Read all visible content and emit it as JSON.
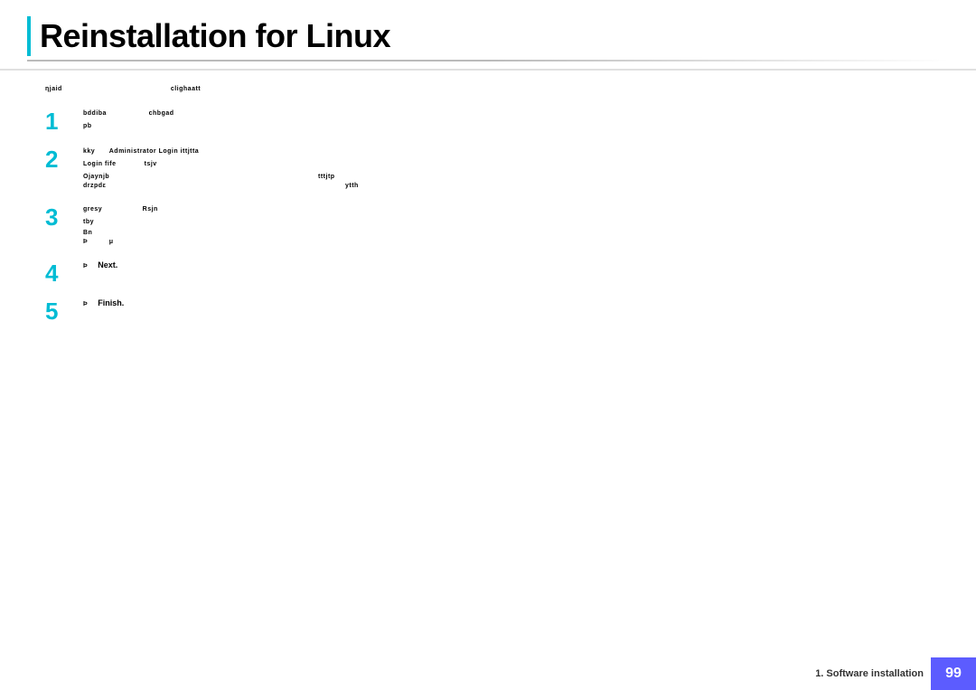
{
  "page": {
    "title": "Reinstallation for Linux",
    "left_bar_color": "#00bcd4"
  },
  "header": {
    "col1": "ηjaid",
    "col2": "clighaatt"
  },
  "steps": [
    {
      "number": "1",
      "lines": [
        {
          "text": "bddiba",
          "extra": "chbgad"
        },
        {
          "text": "pb"
        }
      ]
    },
    {
      "number": "2",
      "lines": [
        {
          "text": "kky",
          "bold": "Administrator Login ittjtta"
        },
        {
          "text": "Login fife",
          "extra": "tsjv"
        }
      ],
      "sub": [
        {
          "col1": "Ojaynjb",
          "col2": "tttjtp"
        },
        {
          "col1": "drzpdε",
          "extra": "ytth"
        }
      ]
    },
    {
      "number": "3",
      "lines": [
        {
          "text": "gresy",
          "extra": "Rsjn"
        },
        {
          "text": "tby"
        }
      ],
      "bullets": [
        {
          "text": "Bn"
        },
        {
          "text": "Þ",
          "extra": "μ"
        }
      ]
    },
    {
      "number": "4",
      "line": "Þ",
      "bold": "Next."
    },
    {
      "number": "5",
      "line": "Þ",
      "bold": "Finish."
    }
  ],
  "footer": {
    "label": "1.  Software installation",
    "page": "99"
  }
}
